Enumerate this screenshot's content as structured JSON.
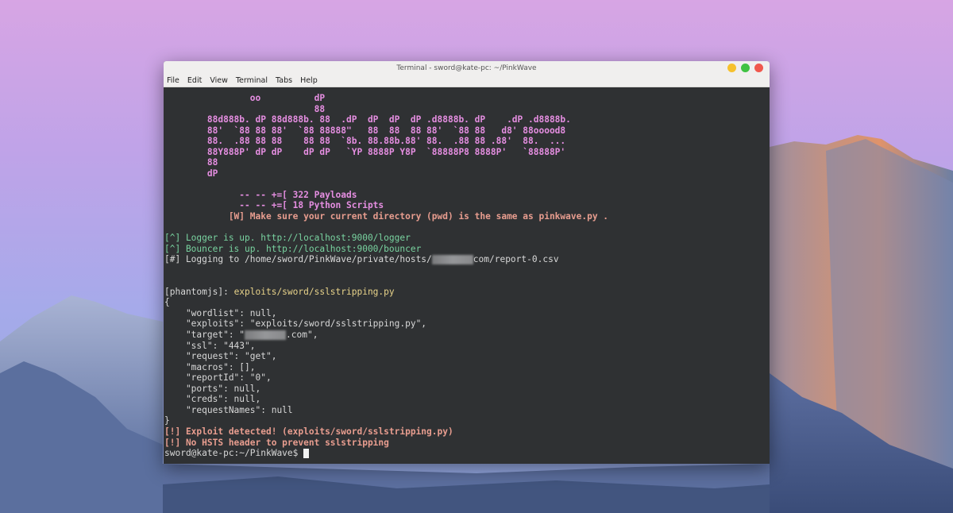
{
  "window": {
    "title": "Terminal - sword@kate-pc: ~/PinkWave",
    "colors": {
      "minimize": "#f6c12d",
      "maximize": "#3fc242",
      "close": "#f0574d"
    }
  },
  "menubar": {
    "items": [
      "File",
      "Edit",
      "View",
      "Terminal",
      "Tabs",
      "Help"
    ]
  },
  "terminal": {
    "art": [
      "                oo          dP",
      "                            88",
      "        88d888b. dP 88d888b. 88  .dP  dP  dP  dP .d8888b. dP    .dP .d8888b.",
      "        88'  `88 88 88'  `88 88888\"   88  88  88 88'  `88 88   d8' 88ooood8",
      "        88.  .88 88 88    88 88  `8b. 88.88b.88' 88.  .88 88 .88'  88.  ...",
      "        88Y888P' dP dP    dP dP   `YP 8888P Y8P  `88888P8 8888P'   `88888P'",
      "        88",
      "        dP"
    ],
    "banner_payloads": "              -- -- +=[ 322 Payloads",
    "banner_scripts": "              -- -- +=[ 18 Python Scripts",
    "banner_warning": "            [W] Make sure your current directory (pwd) is the same as pinkwave.py .",
    "logger_line": "[^] Logger is up. http://localhost:9000/logger",
    "bouncer_line": "[^] Bouncer is up. http://localhost:9000/bouncer",
    "logging_prefix": "[#] Logging to /home/sword/PinkWave/private/hosts/",
    "logging_suffix": "com/report-0.csv",
    "phantom_prefix": "[phantomjs]: ",
    "phantom_script": "exploits/sword/sslstripping.py",
    "json_open": "{",
    "json_lines": [
      "    \"wordlist\": null,",
      "    \"exploits\": \"exploits/sword/sslstripping.py\","
    ],
    "target_prefix": "    \"target\": \"",
    "target_suffix": ".com\",",
    "json_lines_2": [
      "    \"ssl\": \"443\",",
      "    \"request\": \"get\",",
      "    \"macros\": [],",
      "    \"reportId\": \"0\",",
      "    \"ports\": null,",
      "    \"creds\": null,",
      "    \"requestNames\": null"
    ],
    "json_close": "}",
    "exploit_detected": "[!] Exploit detected! (exploits/sword/sslstripping.py)",
    "no_hsts": "[!] No HSTS header to prevent sslstripping",
    "prompt": "sword@kate-pc:~/PinkWave$ "
  }
}
